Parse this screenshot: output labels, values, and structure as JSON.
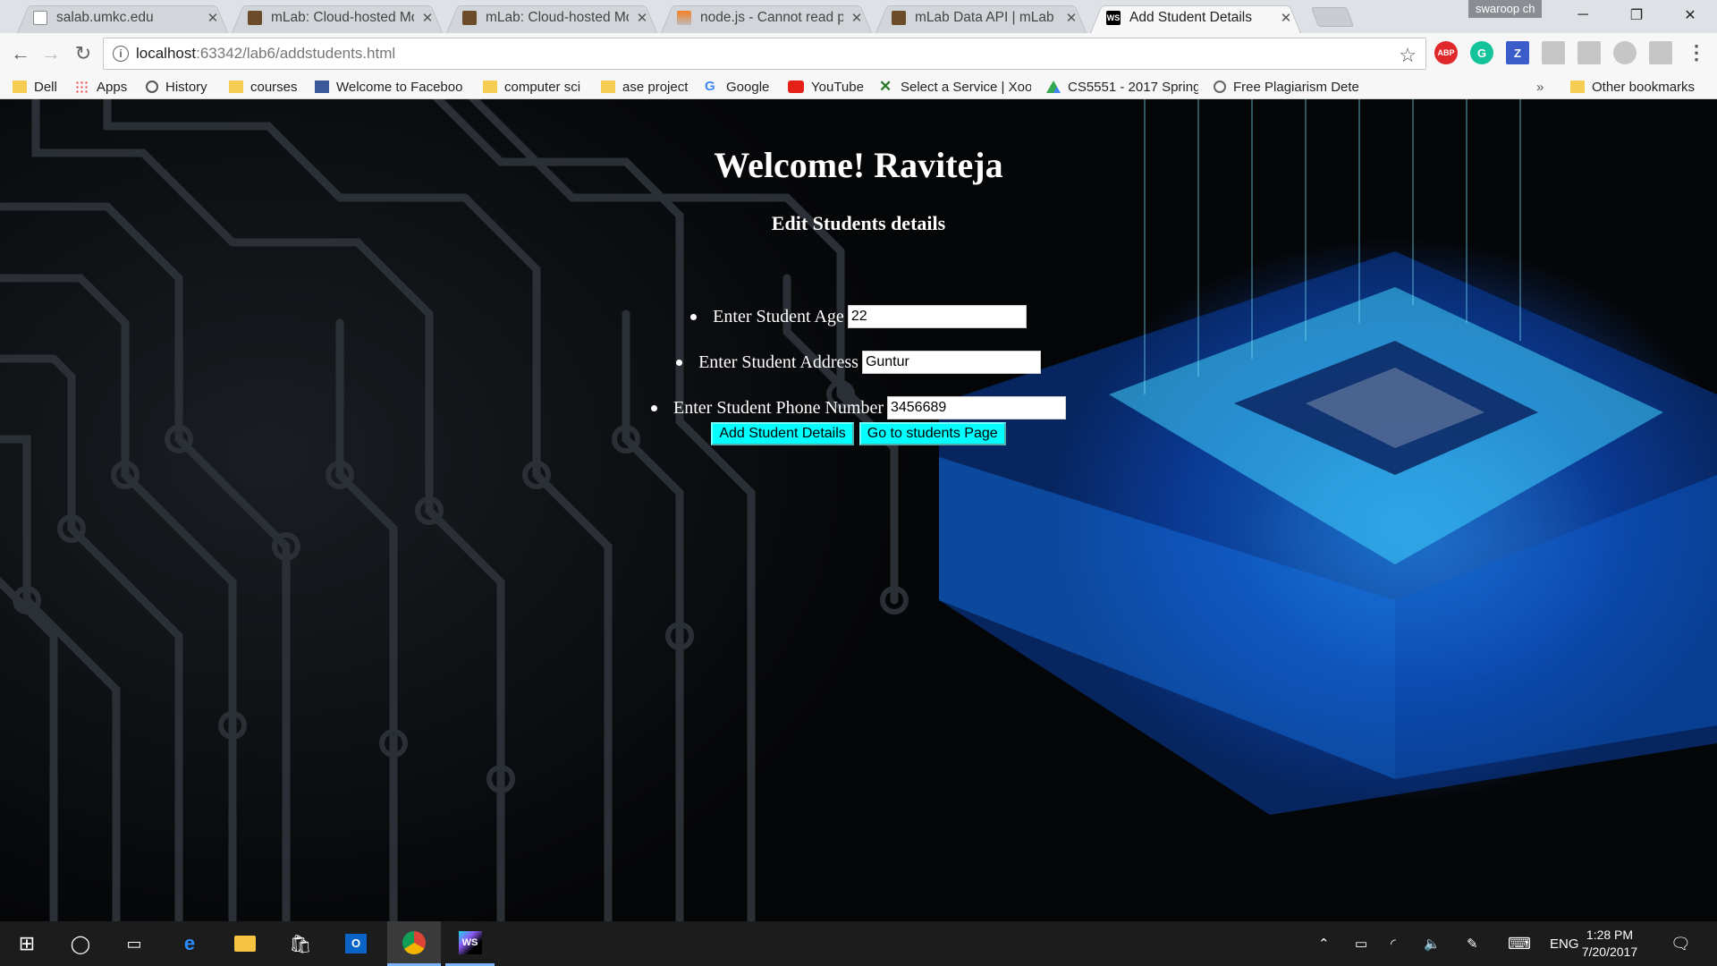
{
  "browser": {
    "tabs": [
      {
        "title": "salab.umkc.edu",
        "icon": "page-icon",
        "active": false
      },
      {
        "title": "mLab: Cloud-hosted Mo",
        "icon": "mlab-icon",
        "active": false
      },
      {
        "title": "mLab: Cloud-hosted Mo",
        "icon": "mlab-icon",
        "active": false
      },
      {
        "title": "node.js - Cannot read pr",
        "icon": "stackoverflow-icon",
        "active": false
      },
      {
        "title": "mLab Data API | mLab D",
        "icon": "mlab-icon",
        "active": false
      },
      {
        "title": "Add Student Details",
        "icon": "webstorm-icon",
        "active": true
      }
    ],
    "profile_name": "swaroop ch",
    "url_host": "localhost",
    "url_path": ":63342/lab6/addstudents.html",
    "extensions": [
      {
        "name": "adblock-icon",
        "label": "ABP",
        "color": "#e0282a"
      },
      {
        "name": "grammarly-icon",
        "label": "G",
        "color": "#15c39a"
      },
      {
        "name": "zotero-icon",
        "label": "Z",
        "color": "#3b5dc9"
      }
    ],
    "bookmarks": [
      {
        "label": "Dell",
        "icon": "folder-icon"
      },
      {
        "label": "Apps",
        "icon": "apps-icon"
      },
      {
        "label": "History",
        "icon": "history-icon"
      },
      {
        "label": "courses",
        "icon": "folder-icon"
      },
      {
        "label": "Welcome to Faceboo",
        "icon": "facebook-icon"
      },
      {
        "label": "computer sci",
        "icon": "folder-icon"
      },
      {
        "label": "ase project",
        "icon": "folder-icon"
      },
      {
        "label": "Google",
        "icon": "google-icon"
      },
      {
        "label": "YouTube",
        "icon": "youtube-icon"
      },
      {
        "label": "Select a Service | Xoo",
        "icon": "xoom-icon"
      },
      {
        "label": "CS5551 - 2017 Spring",
        "icon": "drive-icon"
      },
      {
        "label": "Free Plagiarism Dete",
        "icon": "search-icon"
      }
    ],
    "overflow_label": "»",
    "other_bookmarks": "Other bookmarks"
  },
  "page": {
    "welcome_heading": "Welcome! Raviteja",
    "subheading": "Edit Students details",
    "fields": [
      {
        "label": "Enter Student Age",
        "value": "22"
      },
      {
        "label": "Enter Student Address",
        "value": "Guntur"
      },
      {
        "label": "Enter Student Phone Number",
        "value": "3456689"
      }
    ],
    "add_button": "Add Student Details",
    "go_button": "Go to students Page"
  },
  "taskbar": {
    "language": "ENG",
    "time": "1:28 PM",
    "date": "7/20/2017"
  }
}
